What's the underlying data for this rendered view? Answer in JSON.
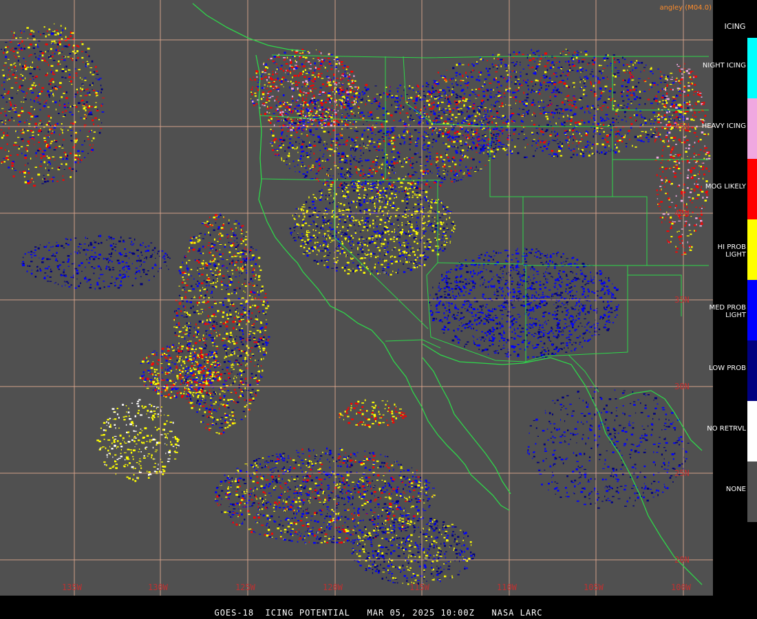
{
  "attribution": "angley (M04.0)",
  "footer": "GOES-18  ICING POTENTIAL   MAR 05, 2025 10:00Z   NASA LARC",
  "legend": {
    "title": "ICING",
    "items": [
      {
        "label": "NIGHT ICING",
        "color": "#00ffff"
      },
      {
        "label": "HEAVY ICING",
        "color": "#f0a8e0"
      },
      {
        "label": "MOG LIKELY",
        "color": "#ff0000"
      },
      {
        "label": "HI PROB LIGHT",
        "color": "#ffff00"
      },
      {
        "label": "MED PROB LIGHT",
        "color": "#0000ff"
      },
      {
        "label": "LOW PROB",
        "color": "#000080"
      },
      {
        "label": "NO RETRVL",
        "color": "#ffffff"
      },
      {
        "label": "NONE",
        "color": "#505050"
      }
    ]
  },
  "grid": {
    "lat_labels": [
      "45N",
      "40N",
      "35N",
      "30N",
      "25N",
      "20N"
    ],
    "lon_labels": [
      "135W",
      "130W",
      "125W",
      "120W",
      "115W",
      "110W",
      "105W",
      "100W"
    ]
  },
  "colors": {
    "background": "#505050",
    "coast": "#2ed84a",
    "grid": "#e0a890",
    "grid_label": "#c03030"
  }
}
